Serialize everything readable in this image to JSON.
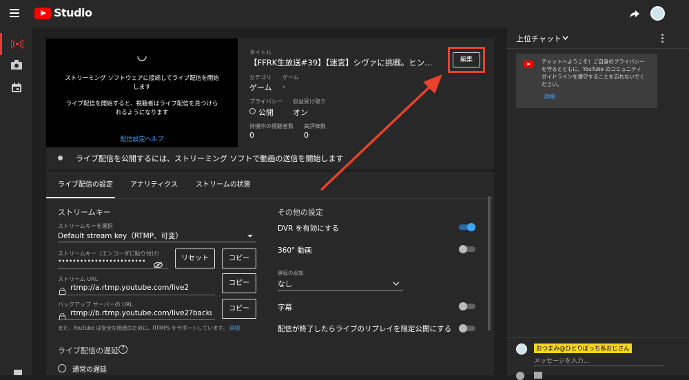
{
  "app": {
    "logo_text": "Studio"
  },
  "preview": {
    "line1": "ストリーミング ソフトウェアに接続してライブ配信を開始",
    "line2": "します",
    "line3": "ライブ配信を開始すると、視聴者はライブ配信を見つけら",
    "line4": "れるようになります",
    "help_link": "配信設定ヘルプ"
  },
  "details": {
    "title_label": "タイトル",
    "title_value": "【FFRK生放送#39】【迷宮】シヴァに挑戦。ヒン...",
    "category_label": "カテゴリ",
    "category_value": "ゲーム",
    "game_label": "ゲーム",
    "game_value": "-",
    "privacy_label": "プライバシー",
    "privacy_value": "公開",
    "monetize_label": "収益受け取り",
    "monetize_value": "オン",
    "waiting_label": "待機中の視聴者数",
    "waiting_value": "0",
    "likes_label": "高評価数",
    "likes_value": "0",
    "edit_button": "編集"
  },
  "status_message": "ライブ配信を公開するには、ストリーミング ソフトで動画の送信を開始します",
  "tabs": [
    {
      "label": "ライブ配信の設定",
      "active": true
    },
    {
      "label": "アナリティクス",
      "active": false
    },
    {
      "label": "ストリームの状態",
      "active": false
    }
  ],
  "stream": {
    "section_title": "ストリームキー",
    "key_select_label": "ストリームキーを選択",
    "key_select_value": "Default stream key（RTMP、可変）",
    "key_label": "ストリームキー（エンコーダに貼り付け）",
    "key_value": "••••••••••••••••••••••••",
    "reset_button": "リセット",
    "copy_button": "コピー",
    "url_label": "ストリーム URL",
    "url_value": "rtmp://a.rtmp.youtube.com/live2",
    "backup_label": "バックアップ サーバーの URL",
    "backup_value": "rtmp://b.rtmp.youtube.com/live2?backup",
    "rtmps_note": "また、YouTube は安全な接続のために、RTMPS をサポートしています。",
    "rtmps_link": "詳細",
    "latency_title": "ライブ配信の遅延",
    "latency_option": "通常の遅延"
  },
  "other": {
    "section_title": "その他の設定",
    "dvr_label": "DVR を有効にする",
    "dvr_on": true,
    "vr_label": "360° 動画",
    "vr_on": false,
    "delay_label": "遅延の追加",
    "delay_value": "なし",
    "captions_label": "字幕",
    "captions_on": false,
    "replay_label": "配信が終了したらライブのリプレイを限定公開にする",
    "replay_on": false
  },
  "chat": {
    "header": "上位チャット",
    "welcome": [
      "チャットへようこそ！ご自身のプライバシー",
      "を守るとともに、YouTube のコミュニティ",
      "ガイドラインを遵守することを忘れないでく",
      "ださい。"
    ],
    "details_link": "詳細",
    "user_name": "おつまみ@ひとりぼっち系おじさん",
    "input_placeholder": "メッセージを入力..."
  },
  "colors": {
    "accent": "#3ea6ff",
    "brand_red": "#ff0000",
    "annotation_red": "#e8432c"
  }
}
